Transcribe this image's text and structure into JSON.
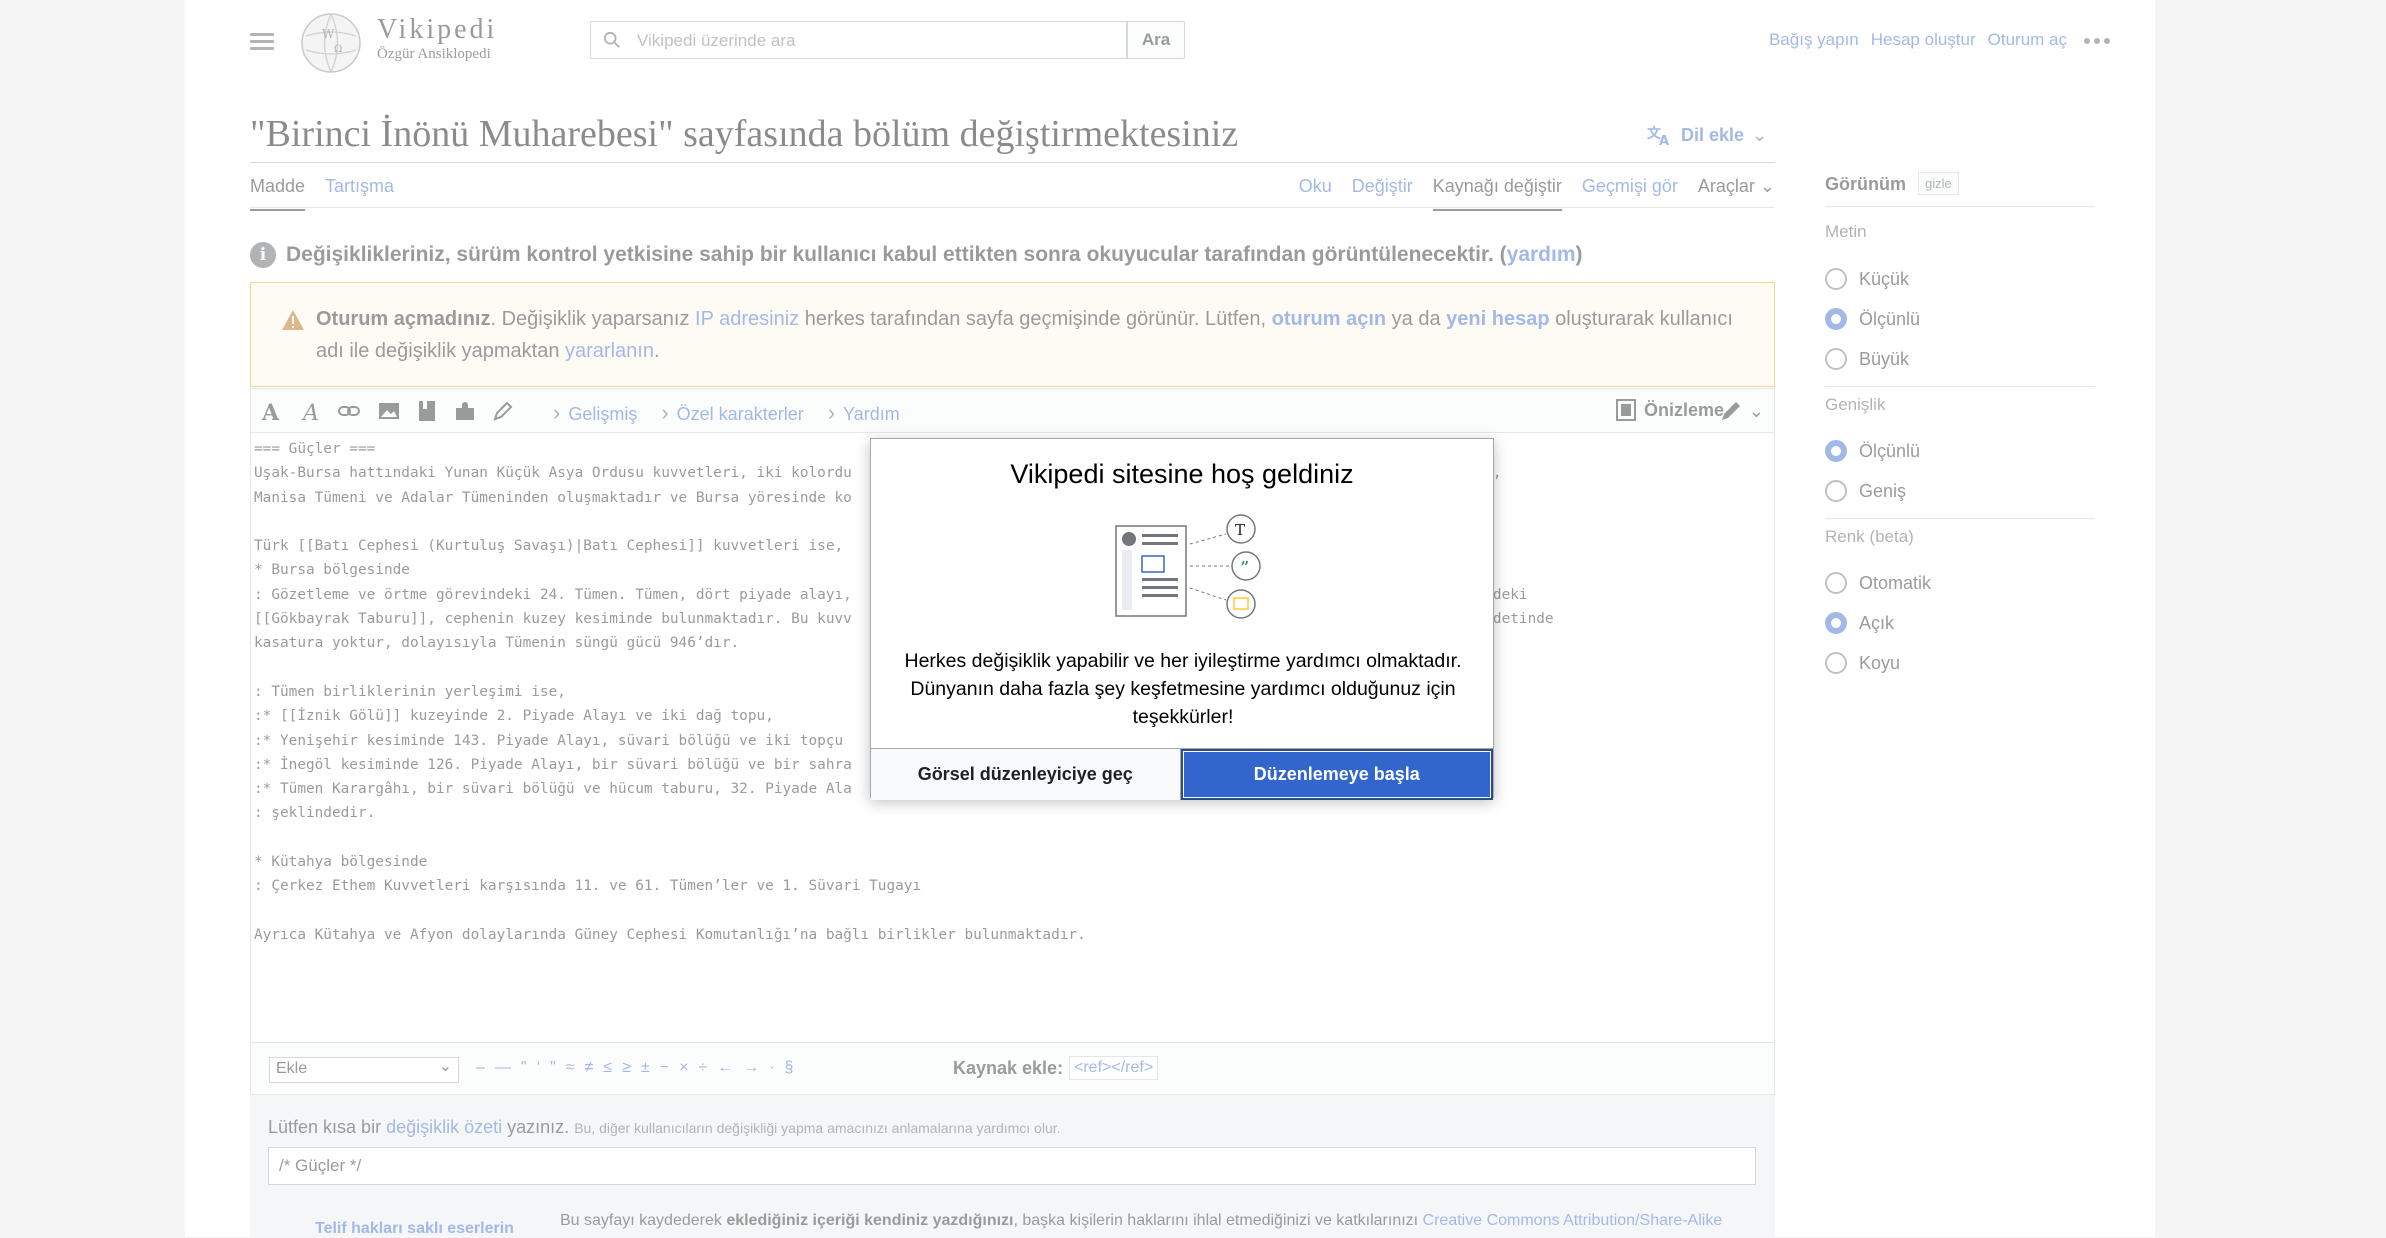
{
  "header": {
    "wordmark": "Vikipedi",
    "tagline": "Özgür Ansiklopedi",
    "search_placeholder": "Vikipedi üzerinde ara",
    "search_button": "Ara",
    "user_links": [
      "Bağış yapın",
      "Hesap oluştur",
      "Oturum aç"
    ]
  },
  "page": {
    "title": "\"Birinci İnönü Muharebesi\" sayfasında bölüm değiştirmektesiniz",
    "lang_button": "Dil ekle",
    "tabs_left": [
      "Madde",
      "Tartışma"
    ],
    "tabs_right": [
      "Oku",
      "Değiştir",
      "Kaynağı değiştir",
      "Geçmişi gör",
      "Araçlar"
    ],
    "flagged_text": "Değişiklikleriniz, sürüm kontrol yetkisine sahip bir kullanıcı kabul ettikten sonra okuyucular tarafından görüntülenecektir. (",
    "flagged_link": "yardım",
    "flagged_end": ")"
  },
  "warning": {
    "bold": "Oturum açmadınız",
    "t1": ". Değişiklik yaparsanız ",
    "link1": "IP adresiniz",
    "t2": " herkes tarafından sayfa geçmişinde görünür. Lütfen, ",
    "link2": "oturum açın",
    "t3": " ya da ",
    "link3": "yeni hesap",
    "t4": " oluşturarak kullanıcı adı ile değişiklik yapmaktan ",
    "link4": "yararlanın",
    "t5": "."
  },
  "editor": {
    "toolbar_tabs": [
      "Gelişmiş",
      "Özel karakterler",
      "Yardım"
    ],
    "preview": "Önizleme",
    "wikitext": "=== Güçler ===\nUşak-Bursa hattındaki Yunan Küçük Asya Ordusu kuvvetleri, iki kolordu                                                   Kolordusu, İzmir Tümeni,\nManisa Tümeni ve Adalar Tümeninden oluşmaktadır ve Bursa yöresinde ko                                                  şmaktadır.\n\nTürk [[Batı Cephesi (Kurtuluş Savaşı)|Batı Cephesi]] kuvvetleri ise,\n* Bursa bölgesinde\n: Gözetleme ve örtme görevindeki 24. Tümen. Tümen, dört piyade alayı,                                                  ephesi Komutanlığı emrindeki\n[[Gökbayrak Taburu]], cephenin kuzey kesiminde bulunmaktadır. Bu kuvv                                                  tur. Tüfeklerden 1.320 adetinde\nkasatura yoktur, dolayısıyla Tümenin süngü gücü 946’dır.\n\n: Tümen birliklerinin yerleşimi ise,\n:* [[İznik Gölü]] kuzeyinde 2. Piyade Alayı ve iki dağ topu,\n:* Yenişehir kesiminde 143. Piyade Alayı, süvari bölüğü ve iki topçu\n:* İnegöl kesiminde 126. Piyade Alayı, bir süvari bölüğü ve bir sahra\n:* Tümen Karargâhı, bir süvari bölüğü ve hücum taburu, 32. Piyade Ala\n: şeklindedir.\n\n* Kütahya bölgesinde\n: Çerkez Ethem Kuvvetleri karşısında 11. ve 61. Tümen’ler ve 1. Süvari Tugayı\n\nAyrıca Kütahya ve Afyon dolaylarında Güney Cephesi Komutanlığı’na bağlı birlikler bulunmaktadır."
  },
  "chars_bar": {
    "select_value": "Ekle",
    "chars": [
      "–",
      "—",
      "\"",
      "‘",
      "\"",
      "≈",
      "≠",
      "≤",
      "≥",
      "±",
      "−",
      "×",
      "÷",
      "←",
      "→",
      "·",
      "§"
    ],
    "kaynak_label": "Kaynak ekle:",
    "ref_chip": "<ref></ref>"
  },
  "summary": {
    "label_pre": "Lütfen kısa bir ",
    "label_link": "değişiklik özeti",
    "label_post": " yazınız.",
    "hint": "Bu, diğer kullanıcıların değişikliği yapma amacınızı anlamalarına yardımcı olur.",
    "value": "/* Güçler */",
    "copyright_head": "Telif hakları saklı eserlerin",
    "copyright_t1": "Bu sayfayı kaydederek ",
    "copyright_bold": "eklediğiniz içeriği kendiniz yazdığınızı",
    "copyright_t2": ", başka kişilerin haklarını ihlal etmediğinizi ve katkılarınızı ",
    "copyright_link": "Creative Commons Attribution/Share-Alike"
  },
  "sidebar": {
    "title": "Görünüm",
    "hide": "gizle",
    "text_heading": "Metin",
    "text_options": [
      {
        "label": "Küçük",
        "checked": false
      },
      {
        "label": "Ölçünlü",
        "checked": true
      },
      {
        "label": "Büyük",
        "checked": false
      }
    ],
    "width_heading": "Genişlik",
    "width_options": [
      {
        "label": "Ölçünlü",
        "checked": true
      },
      {
        "label": "Geniş",
        "checked": false
      }
    ],
    "color_heading": "Renk (beta)",
    "color_options": [
      {
        "label": "Otomatik",
        "checked": false
      },
      {
        "label": "Açık",
        "checked": true
      },
      {
        "label": "Koyu",
        "checked": false
      }
    ]
  },
  "modal": {
    "title": "Vikipedi sitesine hoş geldiniz",
    "body": "Herkes değişiklik yapabilir ve her iyileştirme yardımcı olmaktadır. Dünyanın daha fazla şey keşfetmesine yardımcı olduğunuz için teşekkürler!",
    "btn_visual": "Görsel düzenleyiciye geç",
    "btn_start": "Düzenlemeye başla"
  }
}
